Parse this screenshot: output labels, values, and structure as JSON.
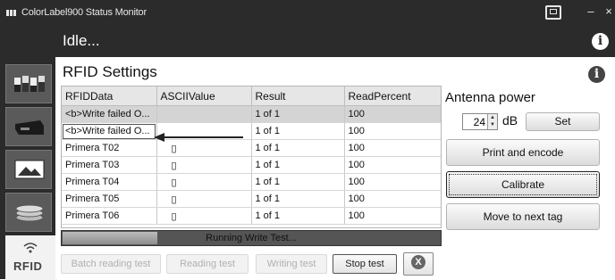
{
  "window": {
    "title": "ColorLabel900 Status Monitor",
    "controls": {
      "restore_icon": "restore-icon",
      "minimize": "–",
      "close": "×"
    }
  },
  "status": {
    "text": "Idle...",
    "info_icon": "i"
  },
  "sidebar": {
    "tabs": [
      {
        "name": "sidebar-tab-ink-levels",
        "icon": "ink-cartridges-icon"
      },
      {
        "name": "sidebar-tab-printer",
        "icon": "printer-cartridge-icon"
      },
      {
        "name": "sidebar-tab-media",
        "icon": "image-icon"
      },
      {
        "name": "sidebar-tab-maintenance",
        "icon": "coins-stack-icon"
      },
      {
        "name": "sidebar-tab-rfid",
        "icon": "rfid-wave-icon",
        "label": "RFID",
        "active": true
      }
    ]
  },
  "rfid": {
    "heading": "RFID Settings",
    "info_icon": "i",
    "columns": [
      "RFIDData",
      "ASCIIValue",
      "Result",
      "ReadPercent"
    ],
    "rows": [
      {
        "rfid": "<b>Write failed O...",
        "ascii": "",
        "result": "1 of 1",
        "percent": "100",
        "selected": true
      },
      {
        "rfid": "<b>Write failed O...",
        "ascii": "",
        "result": "1 of 1",
        "percent": "100"
      },
      {
        "rfid": "Primera T02",
        "ascii": "▯",
        "result": "1 of 1",
        "percent": "100"
      },
      {
        "rfid": "Primera T03",
        "ascii": "▯",
        "result": "1 of 1",
        "percent": "100"
      },
      {
        "rfid": "Primera T04",
        "ascii": "▯",
        "result": "1 of 1",
        "percent": "100"
      },
      {
        "rfid": "Primera T05",
        "ascii": "▯",
        "result": "1 of 1",
        "percent": "100"
      },
      {
        "rfid": "Primera T06",
        "ascii": "▯",
        "result": "1 of 1",
        "percent": "100"
      }
    ],
    "progress": {
      "text": "Running Write Test...",
      "fraction": 0.25
    },
    "buttons": {
      "batch": "Batch reading test",
      "reading": "Reading test",
      "writing": "Writing test",
      "stop": "Stop test",
      "close": "X"
    },
    "antenna": {
      "label": "Antenna power",
      "value": "24",
      "unit": "dB",
      "set": "Set"
    },
    "actions": {
      "print_encode": "Print and encode",
      "calibrate": "Calibrate",
      "move_next": "Move to next tag"
    }
  }
}
